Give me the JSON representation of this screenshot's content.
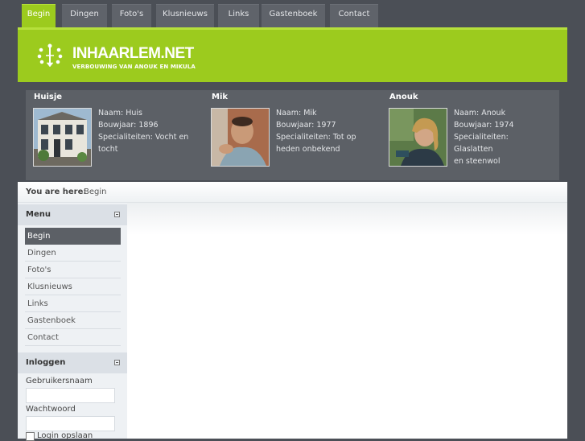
{
  "nav": {
    "tabs": [
      {
        "label": "Begin",
        "active": true
      },
      {
        "label": "Dingen"
      },
      {
        "label": "Foto's"
      },
      {
        "label": "Klusnieuws"
      },
      {
        "label": "Links"
      },
      {
        "label": "Gastenboek"
      },
      {
        "label": "Contact"
      }
    ]
  },
  "header": {
    "title": "INHAARLEM.NET",
    "slogan": "VERBOUWING VAN ANOUK EN MIKULA",
    "logo_icon": "compass-icon",
    "accent_color": "#9ccb1e"
  },
  "profiles": [
    {
      "title": "Huisje",
      "lines": [
        "Naam: Huis",
        "Bouwjaar: 1896",
        "Specialiteiten: Vocht en",
        "tocht"
      ],
      "photo": "house-photo"
    },
    {
      "title": "Mik",
      "lines": [
        "Naam: Mik",
        "Bouwjaar: 1977",
        "Specialiteiten: Tot op",
        "heden onbekend"
      ],
      "photo": "man-photo"
    },
    {
      "title": "Anouk",
      "lines": [
        "Naam: Anouk",
        "Bouwjaar: 1974",
        "Specialiteiten:",
        "Glaslatten",
        "en steenwol"
      ],
      "photo": "woman-photo"
    }
  ],
  "breadcrumb": {
    "label": "You are here:",
    "current": "Begin"
  },
  "menu": {
    "title": "Menu",
    "items": [
      "Begin",
      "Dingen",
      "Foto's",
      "Klusnieuws",
      "Links",
      "Gastenboek",
      "Contact"
    ]
  },
  "login": {
    "title": "Inloggen",
    "username_label": "Gebruikersnaam",
    "username_value": "",
    "password_label": "Wachtwoord",
    "password_value": "",
    "remember_label": "Login opslaan"
  }
}
